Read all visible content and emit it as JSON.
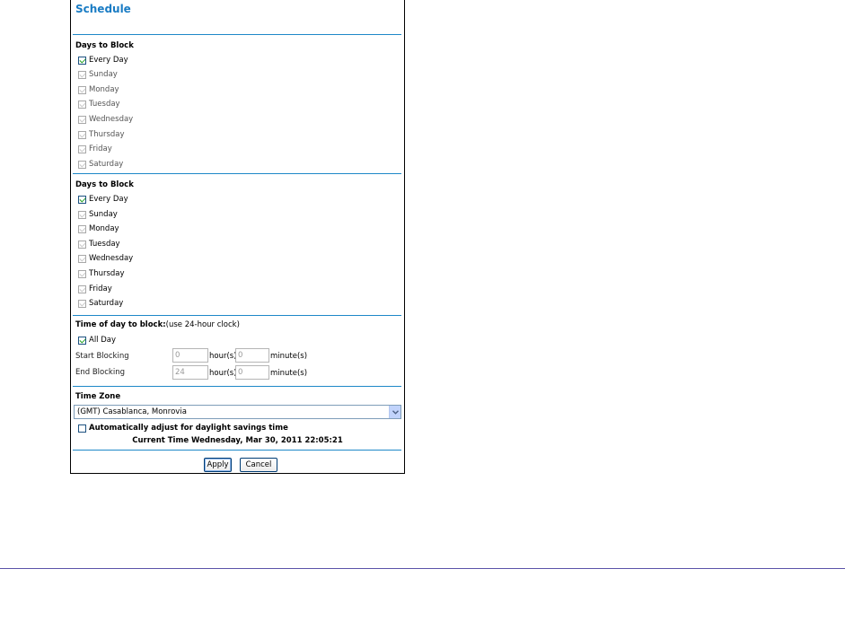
{
  "panel": {
    "title": "Schedule"
  },
  "days_block_1": {
    "heading": "Days to Block",
    "items": [
      {
        "label": "Every Day",
        "checked": true
      },
      {
        "label": "Sunday",
        "checked": true
      },
      {
        "label": "Monday",
        "checked": true
      },
      {
        "label": "Tuesday",
        "checked": true
      },
      {
        "label": "Wednesday",
        "checked": true
      },
      {
        "label": "Thursday",
        "checked": true
      },
      {
        "label": "Friday",
        "checked": true
      },
      {
        "label": "Saturday",
        "checked": true
      }
    ]
  },
  "days_block_2": {
    "heading": "Days to Block",
    "items": [
      {
        "label": "Every Day",
        "checked": true
      },
      {
        "label": "Sunday",
        "checked": true
      },
      {
        "label": "Monday",
        "checked": true
      },
      {
        "label": "Tuesday",
        "checked": true
      },
      {
        "label": "Wednesday",
        "checked": true
      },
      {
        "label": "Thursday",
        "checked": true
      },
      {
        "label": "Friday",
        "checked": true
      },
      {
        "label": "Saturday",
        "checked": true
      }
    ]
  },
  "time_of_day": {
    "heading": "Time of day to block:",
    "heading_note": "(use 24-hour clock)",
    "all_day_label": "All Day",
    "all_day_checked": true,
    "start_label": "Start Blocking",
    "start_hour": "0",
    "start_minute": "0",
    "end_label": "End Blocking",
    "end_hour": "24",
    "end_minute": "0",
    "hour_unit": "hour(s)",
    "minute_unit": "minute(s)"
  },
  "time_zone": {
    "heading": "Time Zone",
    "selected": "(GMT) Casablanca, Monrovia",
    "dst_label": "Automatically adjust for daylight savings time",
    "dst_checked": false,
    "current_time": "Current Time Wednesday, Mar 30, 2011 22:05:21"
  },
  "actions": {
    "apply": "Apply",
    "cancel": "Cancel"
  },
  "colors": {
    "accent": "#1e88c8",
    "title": "#1a7cc4",
    "check": "#21a121",
    "rule": "#5b53a8"
  }
}
